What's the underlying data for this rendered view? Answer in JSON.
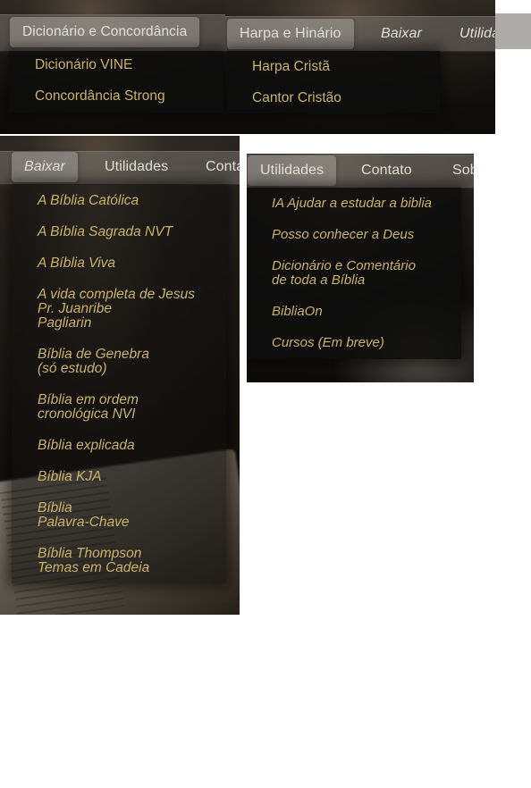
{
  "colors": {
    "menu_text": "#c9b36a",
    "nav_text": "#e6e0d6",
    "dropdown_bg": "#0c0c0c"
  },
  "panel1": {
    "nav": {
      "active_label": "Dicionário e Concordância"
    },
    "dropdown": [
      "Dicionário VINE",
      "Concordância Strong"
    ]
  },
  "panel2": {
    "nav": {
      "tabs": [
        "Harpa e Hinário",
        "Baixar",
        "Utilidades"
      ]
    },
    "dropdown": [
      "Harpa Cristã",
      "Cantor Cristão"
    ]
  },
  "panel3": {
    "nav": {
      "tabs": [
        "Baixar",
        "Utilidades",
        "Contato"
      ]
    },
    "dropdown": [
      "A Bíblia Católica",
      "A Bíblia Sagrada NVT",
      "A Bíblia Viva",
      "A vida completa de Jesus\nPr. Juanribe\nPagliarin",
      "Bíblia de Genebra\n(só estudo)",
      "Bíblia em ordem\ncronológica NVI",
      "Bíblia explicada",
      "Bíblia KJA",
      "Bíblia\nPalavra-Chave",
      "Bíblia Thompson\nTemas em Cadeia"
    ]
  },
  "panel4": {
    "nav": {
      "tabs": [
        "Utilidades",
        "Contato",
        "Sobre"
      ]
    },
    "dropdown": [
      "IA Ajudar a estudar a biblia",
      "Posso conhecer a Deus",
      "Dicionário e Comentário\nde toda a Bíblia",
      "BibliaOn",
      "Cursos (Em breve)"
    ]
  }
}
